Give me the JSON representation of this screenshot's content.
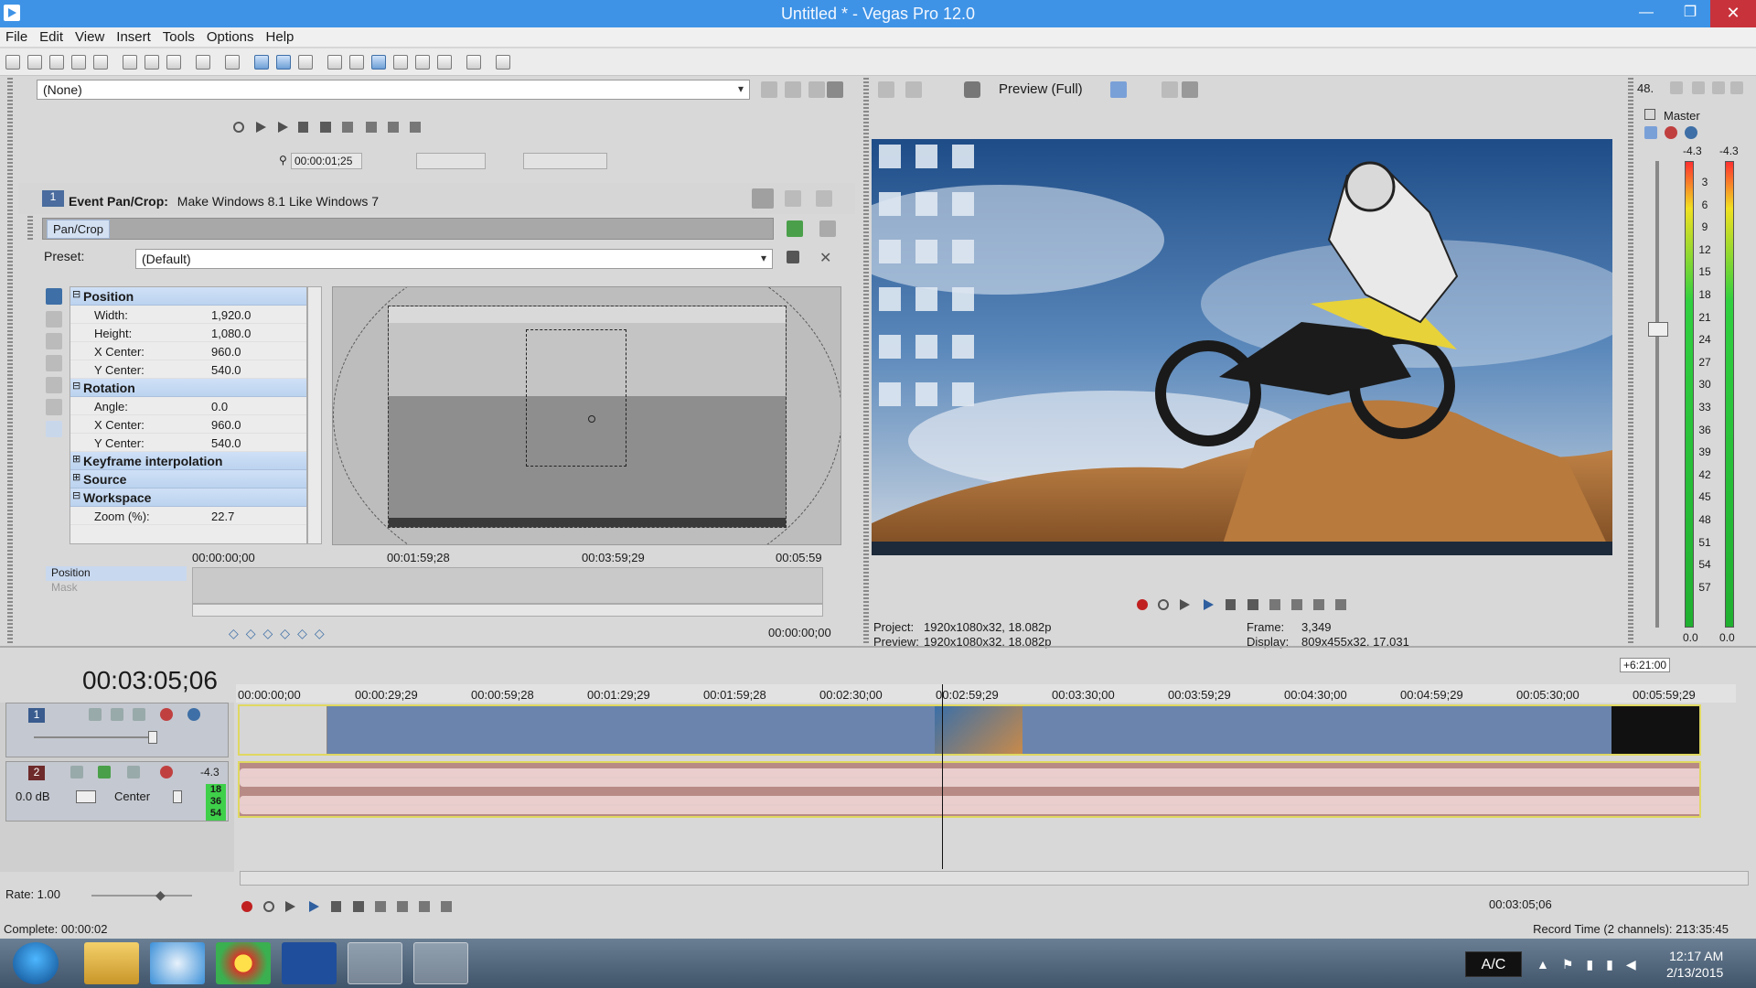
{
  "window": {
    "title": "Untitled * - Vegas Pro 12.0"
  },
  "menu": [
    "File",
    "Edit",
    "View",
    "Insert",
    "Tools",
    "Options",
    "Help"
  ],
  "fx_chain": {
    "combo_value": "(None)",
    "time": "00:00:01;25"
  },
  "pan_crop": {
    "header_label": "Event Pan/Crop:",
    "header_event": "Make Windows 8.1 Like Windows 7",
    "tab_label": "Pan/Crop",
    "preset_label": "Preset:",
    "preset_value": "(Default)",
    "properties": {
      "position": {
        "title": "Position",
        "width_label": "Width:",
        "width_value": "1,920.0",
        "height_label": "Height:",
        "height_value": "1,080.0",
        "xcenter_label": "X Center:",
        "xcenter_value": "960.0",
        "ycenter_label": "Y Center:",
        "ycenter_value": "540.0"
      },
      "rotation": {
        "title": "Rotation",
        "angle_label": "Angle:",
        "angle_value": "0.0",
        "xcenter_label": "X Center:",
        "xcenter_value": "960.0",
        "ycenter_label": "Y Center:",
        "ycenter_value": "540.0"
      },
      "keyframe_interp": "Keyframe interpolation",
      "source": "Source",
      "workspace": {
        "title": "Workspace",
        "zoom_label": "Zoom (%):",
        "zoom_value": "22.7"
      }
    },
    "keyframes": {
      "ruler": [
        "00:00:00;00",
        "00:01:59;28",
        "00:03:59;29",
        "00:05:59"
      ],
      "rows": [
        "Position",
        "Mask"
      ],
      "time": "00:00:00;00"
    }
  },
  "preview": {
    "quality": "Preview (Full)",
    "project_label": "Project:",
    "project_value": "1920x1080x32, 18.082p",
    "preview_label": "Preview:",
    "preview_value": "1920x1080x32, 18.082p",
    "frame_label": "Frame:",
    "frame_value": "3,349",
    "display_label": "Display:",
    "display_value": "809x455x32, 17.031"
  },
  "master": {
    "top_value": "48.",
    "label": "Master",
    "peak_l": "-4.3",
    "peak_r": "-4.3",
    "scale": [
      "3",
      "6",
      "9",
      "12",
      "15",
      "18",
      "21",
      "24",
      "27",
      "30",
      "33",
      "36",
      "39",
      "42",
      "45",
      "48",
      "51",
      "54",
      "57"
    ],
    "foot_l": "0.0",
    "foot_r": "0.0"
  },
  "timeline": {
    "timecode": "00:03:05;06",
    "end_label": "+6:21:00",
    "ruler": [
      "00:00:00;00",
      "00:00:29;29",
      "00:00:59;28",
      "00:01:29;29",
      "00:01:59;28",
      "00:02:30;00",
      "00:02:59;29",
      "00:03:30;00",
      "00:03:59;29",
      "00:04:30;00",
      "00:04:59;29",
      "00:05:30;00",
      "00:05:59;29"
    ],
    "audio": {
      "track_number": "2",
      "level": "-4.3",
      "volume": "0.0 dB",
      "pan": "Center",
      "meter_marks": [
        "18",
        "36",
        "54"
      ]
    },
    "video": {
      "track_number": "1"
    },
    "rate": "Rate: 1.00",
    "cursor_time": "00:03:05;06",
    "complete": "Complete: 00:00:02",
    "record_time": "Record Time (2 channels): 213:35:45"
  },
  "taskbar": {
    "tray_label": "A/C",
    "clock_time": "12:17 AM",
    "clock_date": "2/13/2015"
  }
}
